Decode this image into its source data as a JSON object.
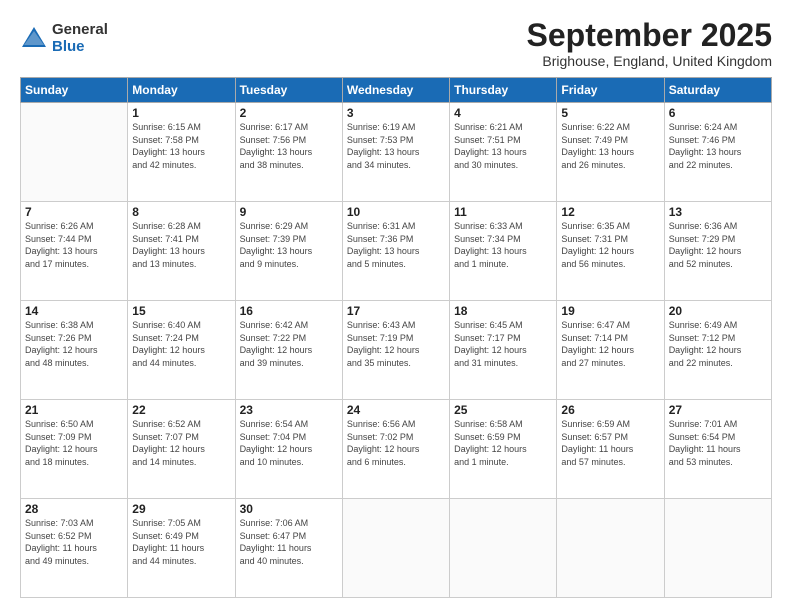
{
  "logo": {
    "general": "General",
    "blue": "Blue"
  },
  "header": {
    "title": "September 2025",
    "subtitle": "Brighouse, England, United Kingdom"
  },
  "days_of_week": [
    "Sunday",
    "Monday",
    "Tuesday",
    "Wednesday",
    "Thursday",
    "Friday",
    "Saturday"
  ],
  "weeks": [
    [
      {
        "day": "",
        "info": ""
      },
      {
        "day": "1",
        "info": "Sunrise: 6:15 AM\nSunset: 7:58 PM\nDaylight: 13 hours\nand 42 minutes."
      },
      {
        "day": "2",
        "info": "Sunrise: 6:17 AM\nSunset: 7:56 PM\nDaylight: 13 hours\nand 38 minutes."
      },
      {
        "day": "3",
        "info": "Sunrise: 6:19 AM\nSunset: 7:53 PM\nDaylight: 13 hours\nand 34 minutes."
      },
      {
        "day": "4",
        "info": "Sunrise: 6:21 AM\nSunset: 7:51 PM\nDaylight: 13 hours\nand 30 minutes."
      },
      {
        "day": "5",
        "info": "Sunrise: 6:22 AM\nSunset: 7:49 PM\nDaylight: 13 hours\nand 26 minutes."
      },
      {
        "day": "6",
        "info": "Sunrise: 6:24 AM\nSunset: 7:46 PM\nDaylight: 13 hours\nand 22 minutes."
      }
    ],
    [
      {
        "day": "7",
        "info": "Sunrise: 6:26 AM\nSunset: 7:44 PM\nDaylight: 13 hours\nand 17 minutes."
      },
      {
        "day": "8",
        "info": "Sunrise: 6:28 AM\nSunset: 7:41 PM\nDaylight: 13 hours\nand 13 minutes."
      },
      {
        "day": "9",
        "info": "Sunrise: 6:29 AM\nSunset: 7:39 PM\nDaylight: 13 hours\nand 9 minutes."
      },
      {
        "day": "10",
        "info": "Sunrise: 6:31 AM\nSunset: 7:36 PM\nDaylight: 13 hours\nand 5 minutes."
      },
      {
        "day": "11",
        "info": "Sunrise: 6:33 AM\nSunset: 7:34 PM\nDaylight: 13 hours\nand 1 minute."
      },
      {
        "day": "12",
        "info": "Sunrise: 6:35 AM\nSunset: 7:31 PM\nDaylight: 12 hours\nand 56 minutes."
      },
      {
        "day": "13",
        "info": "Sunrise: 6:36 AM\nSunset: 7:29 PM\nDaylight: 12 hours\nand 52 minutes."
      }
    ],
    [
      {
        "day": "14",
        "info": "Sunrise: 6:38 AM\nSunset: 7:26 PM\nDaylight: 12 hours\nand 48 minutes."
      },
      {
        "day": "15",
        "info": "Sunrise: 6:40 AM\nSunset: 7:24 PM\nDaylight: 12 hours\nand 44 minutes."
      },
      {
        "day": "16",
        "info": "Sunrise: 6:42 AM\nSunset: 7:22 PM\nDaylight: 12 hours\nand 39 minutes."
      },
      {
        "day": "17",
        "info": "Sunrise: 6:43 AM\nSunset: 7:19 PM\nDaylight: 12 hours\nand 35 minutes."
      },
      {
        "day": "18",
        "info": "Sunrise: 6:45 AM\nSunset: 7:17 PM\nDaylight: 12 hours\nand 31 minutes."
      },
      {
        "day": "19",
        "info": "Sunrise: 6:47 AM\nSunset: 7:14 PM\nDaylight: 12 hours\nand 27 minutes."
      },
      {
        "day": "20",
        "info": "Sunrise: 6:49 AM\nSunset: 7:12 PM\nDaylight: 12 hours\nand 22 minutes."
      }
    ],
    [
      {
        "day": "21",
        "info": "Sunrise: 6:50 AM\nSunset: 7:09 PM\nDaylight: 12 hours\nand 18 minutes."
      },
      {
        "day": "22",
        "info": "Sunrise: 6:52 AM\nSunset: 7:07 PM\nDaylight: 12 hours\nand 14 minutes."
      },
      {
        "day": "23",
        "info": "Sunrise: 6:54 AM\nSunset: 7:04 PM\nDaylight: 12 hours\nand 10 minutes."
      },
      {
        "day": "24",
        "info": "Sunrise: 6:56 AM\nSunset: 7:02 PM\nDaylight: 12 hours\nand 6 minutes."
      },
      {
        "day": "25",
        "info": "Sunrise: 6:58 AM\nSunset: 6:59 PM\nDaylight: 12 hours\nand 1 minute."
      },
      {
        "day": "26",
        "info": "Sunrise: 6:59 AM\nSunset: 6:57 PM\nDaylight: 11 hours\nand 57 minutes."
      },
      {
        "day": "27",
        "info": "Sunrise: 7:01 AM\nSunset: 6:54 PM\nDaylight: 11 hours\nand 53 minutes."
      }
    ],
    [
      {
        "day": "28",
        "info": "Sunrise: 7:03 AM\nSunset: 6:52 PM\nDaylight: 11 hours\nand 49 minutes."
      },
      {
        "day": "29",
        "info": "Sunrise: 7:05 AM\nSunset: 6:49 PM\nDaylight: 11 hours\nand 44 minutes."
      },
      {
        "day": "30",
        "info": "Sunrise: 7:06 AM\nSunset: 6:47 PM\nDaylight: 11 hours\nand 40 minutes."
      },
      {
        "day": "",
        "info": ""
      },
      {
        "day": "",
        "info": ""
      },
      {
        "day": "",
        "info": ""
      },
      {
        "day": "",
        "info": ""
      }
    ]
  ]
}
